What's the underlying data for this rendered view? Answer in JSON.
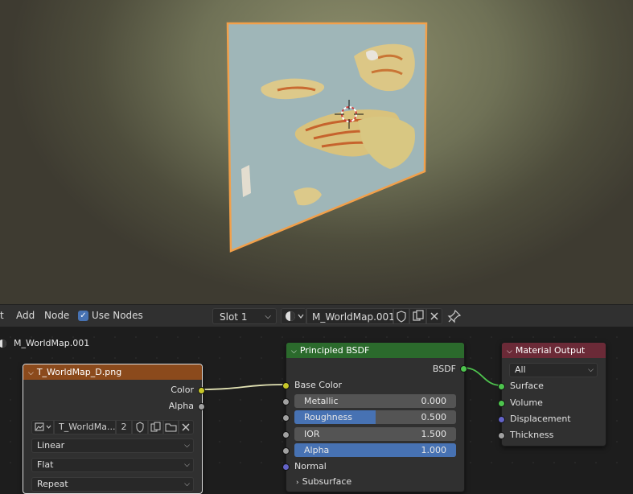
{
  "header": {
    "menu_partial": "t",
    "add_label": "Add",
    "node_label": "Node",
    "use_nodes_label": "Use Nodes",
    "use_nodes_checked": true,
    "slot_label": "Slot 1",
    "material_name": "M_WorldMap.001"
  },
  "editor": {
    "breadcrumb": "M_WorldMap.001"
  },
  "image_node": {
    "title": "T_WorldMap_D.png",
    "outputs": [
      "Color",
      "Alpha"
    ],
    "image_name": "T_WorldMa...",
    "user_count": "2",
    "interpolation": "Linear",
    "projection": "Flat",
    "extension": "Repeat"
  },
  "bsdf_node": {
    "title": "Principled BSDF",
    "output": "BSDF",
    "base_color_label": "Base Color",
    "fields": [
      {
        "label": "Metallic",
        "value": "0.000",
        "fraction": 0.0
      },
      {
        "label": "Roughness",
        "value": "0.500",
        "fraction": 0.5
      },
      {
        "label": "IOR",
        "value": "1.500",
        "fraction": 0.0
      },
      {
        "label": "Alpha",
        "value": "1.000",
        "fraction": 1.0
      }
    ],
    "normal_label": "Normal",
    "subsurface_label": "Subsurface"
  },
  "output_node": {
    "title": "Material Output",
    "target": "All",
    "inputs": [
      "Surface",
      "Volume",
      "Displacement",
      "Thickness"
    ]
  },
  "colors": {
    "image_header": "#8b4a1c",
    "bsdf_header": "#2b6a2c",
    "output_header": "#6b2a37",
    "color_socket": "#c7c729",
    "float_socket": "#a1a1a1",
    "shader_socket": "#4ec44e",
    "vector_socket": "#6363c7",
    "selection_outline": "#f2a04a",
    "accent": "#4772b3"
  }
}
